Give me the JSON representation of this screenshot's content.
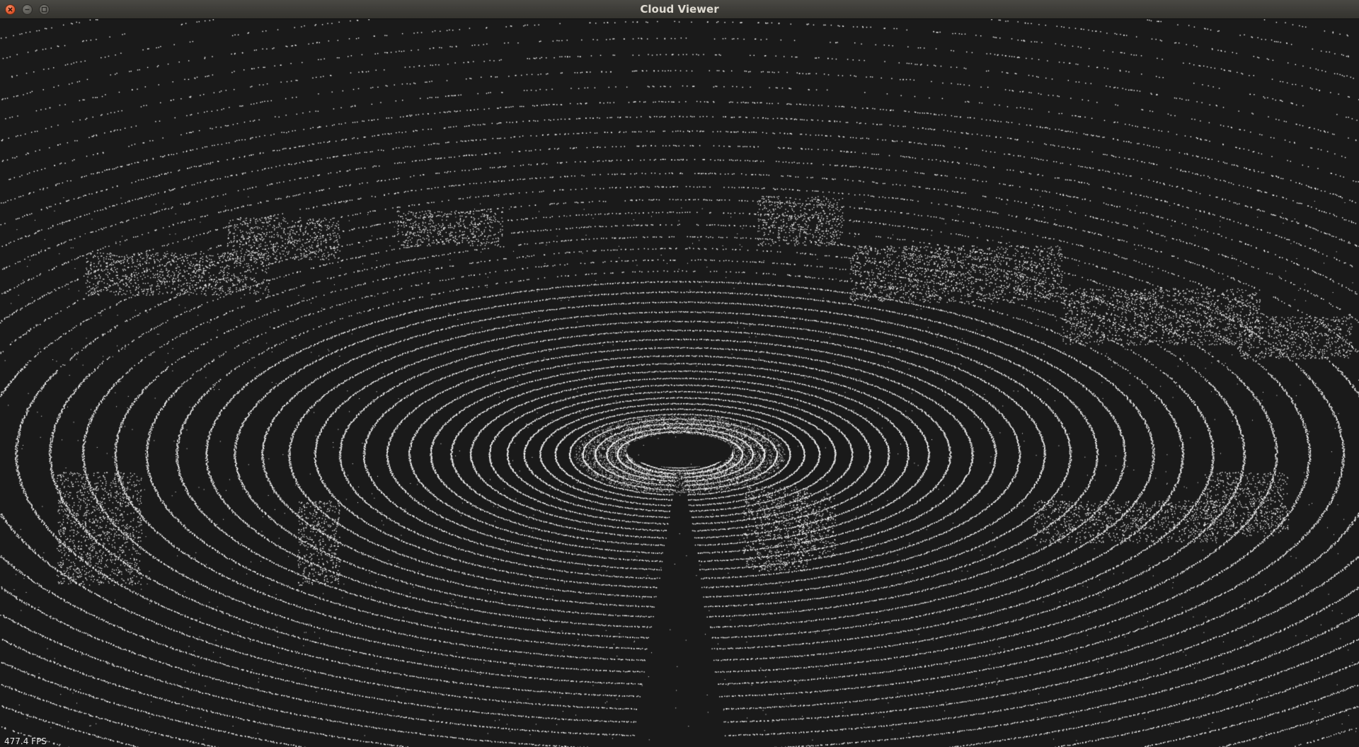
{
  "window": {
    "title": "Cloud Viewer",
    "buttons": {
      "close_icon": "close-icon",
      "minimize_icon": "minimize-icon",
      "maximize_icon": "maximize-icon"
    }
  },
  "viewer": {
    "background_color": "#1a1a1a",
    "point_color": "#ffffff",
    "fps_text": "477.4 FPS"
  }
}
